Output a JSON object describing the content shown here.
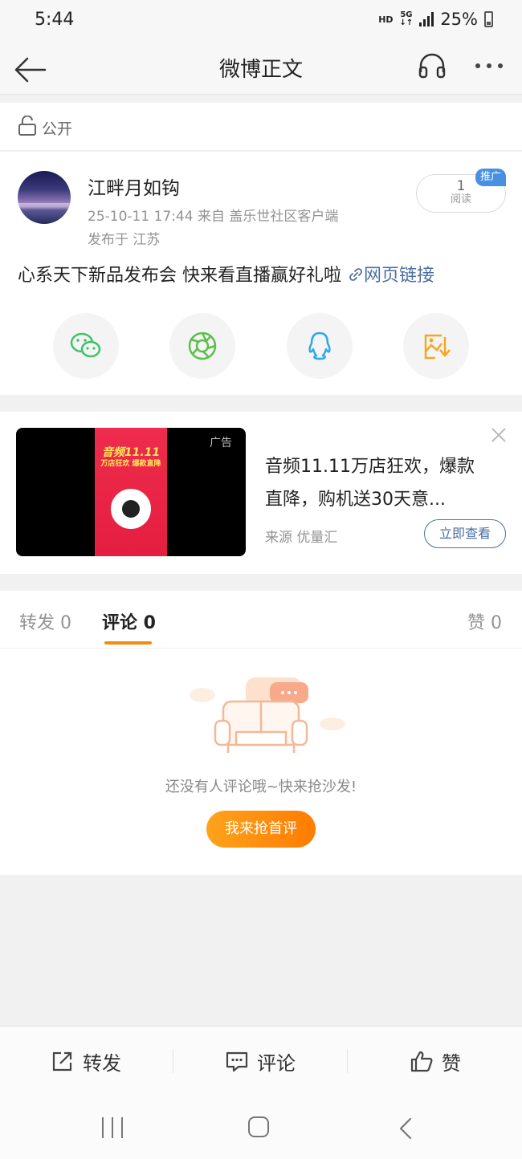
{
  "status_bar": {
    "time": "5:44",
    "hd": "HD",
    "network": "5G",
    "battery": "25%"
  },
  "nav": {
    "title": "微博正文"
  },
  "privacy": {
    "label": "公开"
  },
  "post": {
    "author": "江畔月如钩",
    "meta": "25-10-11 17:44   来自 盖乐世社区客户端",
    "location": "发布于 江苏",
    "read_count": "1",
    "read_label": "阅读",
    "promo_badge": "推广",
    "text": "心系天下新品发布会 快来看直播赢好礼啦",
    "link_label": "网页链接",
    "share_icons": [
      "wechat-icon",
      "moments-icon",
      "qq-icon",
      "save-image-icon"
    ]
  },
  "ad": {
    "tag": "广告",
    "poster_title": "音频11.11",
    "poster_subtitle": "万店狂欢 爆款直降",
    "title": "音频11.11万店狂欢，爆款直降，购机送30天意...",
    "source": "来源 优量汇",
    "cta": "立即查看"
  },
  "comments": {
    "tabs": [
      {
        "label": "转发 0"
      },
      {
        "label": "评论 0"
      },
      {
        "label": "赞 0"
      }
    ],
    "empty_text": "还没有人评论哦~快来抢沙发!",
    "first_button": "我来抢首评"
  },
  "bottom_bar": {
    "repost": "转发",
    "comment": "评论",
    "like": "赞"
  },
  "colors": {
    "accent": "#f78a0c",
    "link": "#4b6fa0",
    "badge": "#4a90e2"
  }
}
